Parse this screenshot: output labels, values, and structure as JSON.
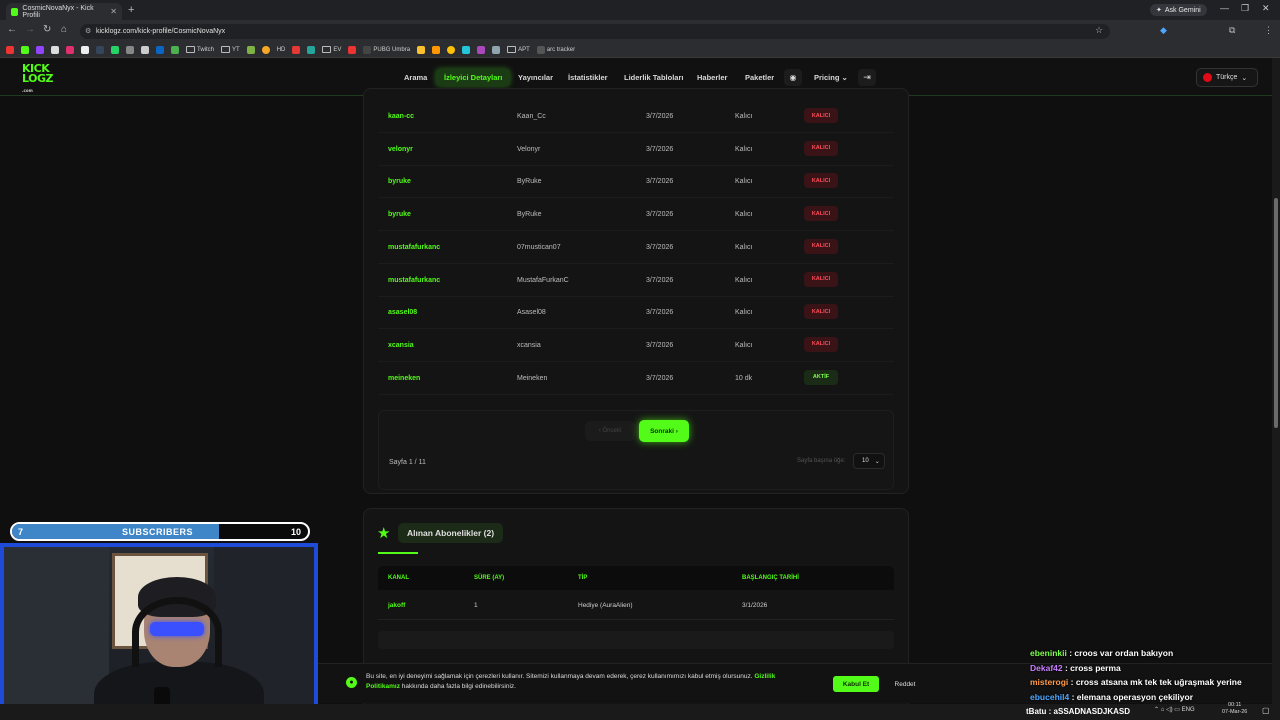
{
  "browser": {
    "tab_title": "CosmicNovaNyx - Kick Profili",
    "new_tab": "+",
    "gemini": "Ask Gemini",
    "url": "kicklogz.com/kick-profile/CosmicNovaNyx",
    "bookmarks": [
      "Twitch",
      "YT",
      "HD",
      "EV",
      "PUBG Umbra",
      "APT",
      "arc tracker"
    ]
  },
  "site": {
    "logo_top": "KICK",
    "logo_bottom": "LOGZ",
    "logo_small": ".com",
    "nav": [
      "Arama",
      "İzleyici Detayları",
      "Yayıncılar",
      "İstatistikler",
      "Liderlik Tabloları",
      "Haberler",
      "Paketler",
      "Pricing"
    ],
    "language": "Türkçe"
  },
  "rows": [
    {
      "user": "kaan-cc",
      "name": "Kaan_Cc",
      "date": "3/7/2026",
      "dur": "Kalıcı",
      "badge": "KALICI"
    },
    {
      "user": "velonyr",
      "name": "Velonyr",
      "date": "3/7/2026",
      "dur": "Kalıcı",
      "badge": "KALICI"
    },
    {
      "user": "byruke",
      "name": "ByRuke",
      "date": "3/7/2026",
      "dur": "Kalıcı",
      "badge": "KALICI"
    },
    {
      "user": "byruke",
      "name": "ByRuke",
      "date": "3/7/2026",
      "dur": "Kalıcı",
      "badge": "KALICI"
    },
    {
      "user": "mustafafurkanc",
      "name": "07mustican07",
      "date": "3/7/2026",
      "dur": "Kalıcı",
      "badge": "KALICI"
    },
    {
      "user": "mustafafurkanc",
      "name": "MustafaFurkanC",
      "date": "3/7/2026",
      "dur": "Kalıcı",
      "badge": "KALICI"
    },
    {
      "user": "asasel08",
      "name": "Asasel08",
      "date": "3/7/2026",
      "dur": "Kalıcı",
      "badge": "KALICI"
    },
    {
      "user": "xcansia",
      "name": "xcansia",
      "date": "3/7/2026",
      "dur": "Kalıcı",
      "badge": "KALICI"
    },
    {
      "user": "meineken",
      "name": "Meineken",
      "date": "3/7/2026",
      "dur": "10 dk",
      "badge": "AKTİF"
    }
  ],
  "pager": {
    "prev": "‹ Önceki",
    "next": "Sonraki ›",
    "page": "Sayfa 1 / 11",
    "per_page_label": "Sayfa başına öğe:",
    "per_page": "10"
  },
  "subs": {
    "title": "Alınan Abonelikler (2)",
    "headers": [
      "KANAL",
      "SÜRE (AY)",
      "TİP",
      "BAŞLANGIÇ TARİHİ"
    ],
    "row": [
      "jakoff",
      "1",
      "Hediye (AuraAlien)",
      "3/1/2026"
    ]
  },
  "cookie": {
    "text": "Bu site, en iyi deneyimi sağlamak için çerezleri kullanır. Sitemizi kullanmaya devam ederek, çerez kullanımımızı kabul etmiş olursunuz.",
    "link": "Gizlilik Politikamız",
    "text2": "hakkında daha fazla bilgi edinebilirsiniz.",
    "accept": "Kabul Et",
    "reject": "Reddet"
  },
  "overlay": {
    "sub_current": "7",
    "sub_label": "SUBSCRIBERS",
    "sub_goal": "10",
    "sub_progress": 0.7
  },
  "chat": [
    {
      "user": "ebeninkii",
      "msg": "croos var ordan bakıyon",
      "color": "#7dff4d"
    },
    {
      "user": "Dekaf42",
      "msg": "cross perma",
      "color": "#c77dff"
    },
    {
      "user": "misterogi",
      "msg": "cross atsana mk tek tek uğraşmak yerine",
      "color": "#ff9b4d"
    },
    {
      "user": "ebucehil4",
      "msg": "elemana operasyon çekiliyor",
      "color": "#4da6ff"
    }
  ],
  "typing": "tBatu : aSSADNASDJKASD",
  "clock": {
    "time": "00:11",
    "date": "07-Mar-26",
    "lang": "ENG"
  }
}
